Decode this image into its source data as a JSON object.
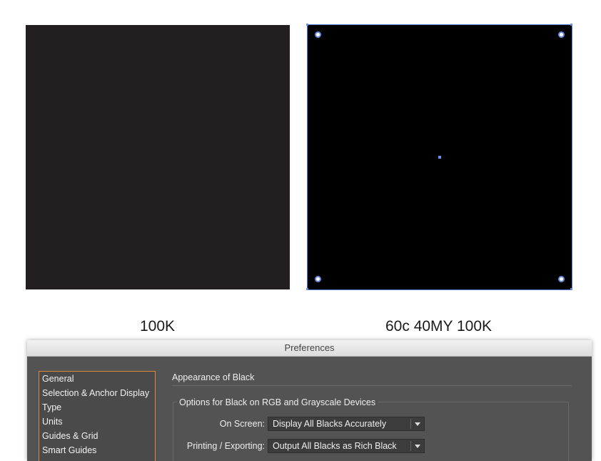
{
  "swatches": {
    "left": {
      "color": "#231f20",
      "caption": "100K"
    },
    "right": {
      "color": "#000000",
      "caption": "60c 40MY 100K",
      "selection_color": "#6b8be8"
    }
  },
  "dialog": {
    "title": "Preferences",
    "sidebar": {
      "items": [
        {
          "label": "General"
        },
        {
          "label": "Selection & Anchor Display"
        },
        {
          "label": "Type"
        },
        {
          "label": "Units"
        },
        {
          "label": "Guides & Grid"
        },
        {
          "label": "Smart Guides"
        }
      ],
      "accent_color": "#d98a3a"
    },
    "section_title": "Appearance of Black",
    "group_title": "Options for Black on RGB and Grayscale Devices",
    "on_screen": {
      "label": "On Screen:",
      "value": "Display All Blacks Accurately"
    },
    "printing": {
      "label": "Printing / Exporting:",
      "value": "Output All Blacks as Rich Black"
    }
  }
}
